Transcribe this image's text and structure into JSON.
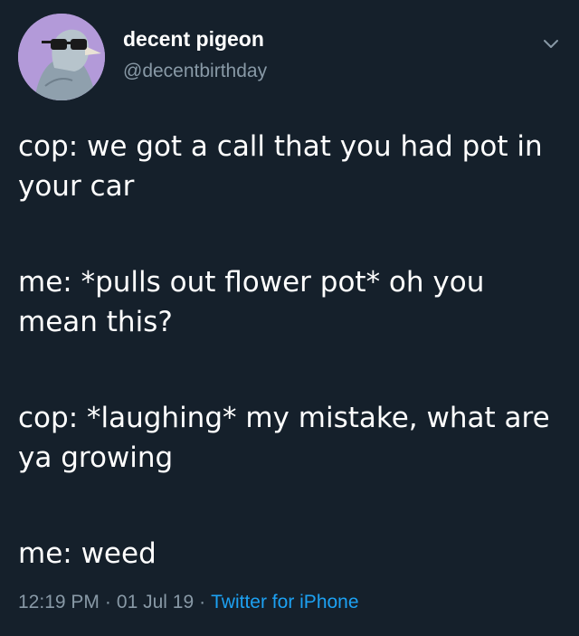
{
  "user": {
    "display_name": "decent pigeon",
    "handle": "@decentbirthday",
    "avatar_icon": "pigeon-with-sunglasses"
  },
  "tweet": {
    "paragraphs": [
      "cop: we got a call that you had pot in your car",
      "me: *pulls out flower pot* oh you mean this?",
      "cop: *laughing* my mistake, what are ya growing",
      "me: weed"
    ]
  },
  "meta": {
    "time": "12:19 PM",
    "separator": "·",
    "date": "01 Jul 19",
    "source": "Twitter for iPhone"
  },
  "colors": {
    "background": "#15202b",
    "text": "#ffffff",
    "secondary": "#8899a6",
    "link": "#1da1f2",
    "avatar_bg": "#b39ad9"
  }
}
